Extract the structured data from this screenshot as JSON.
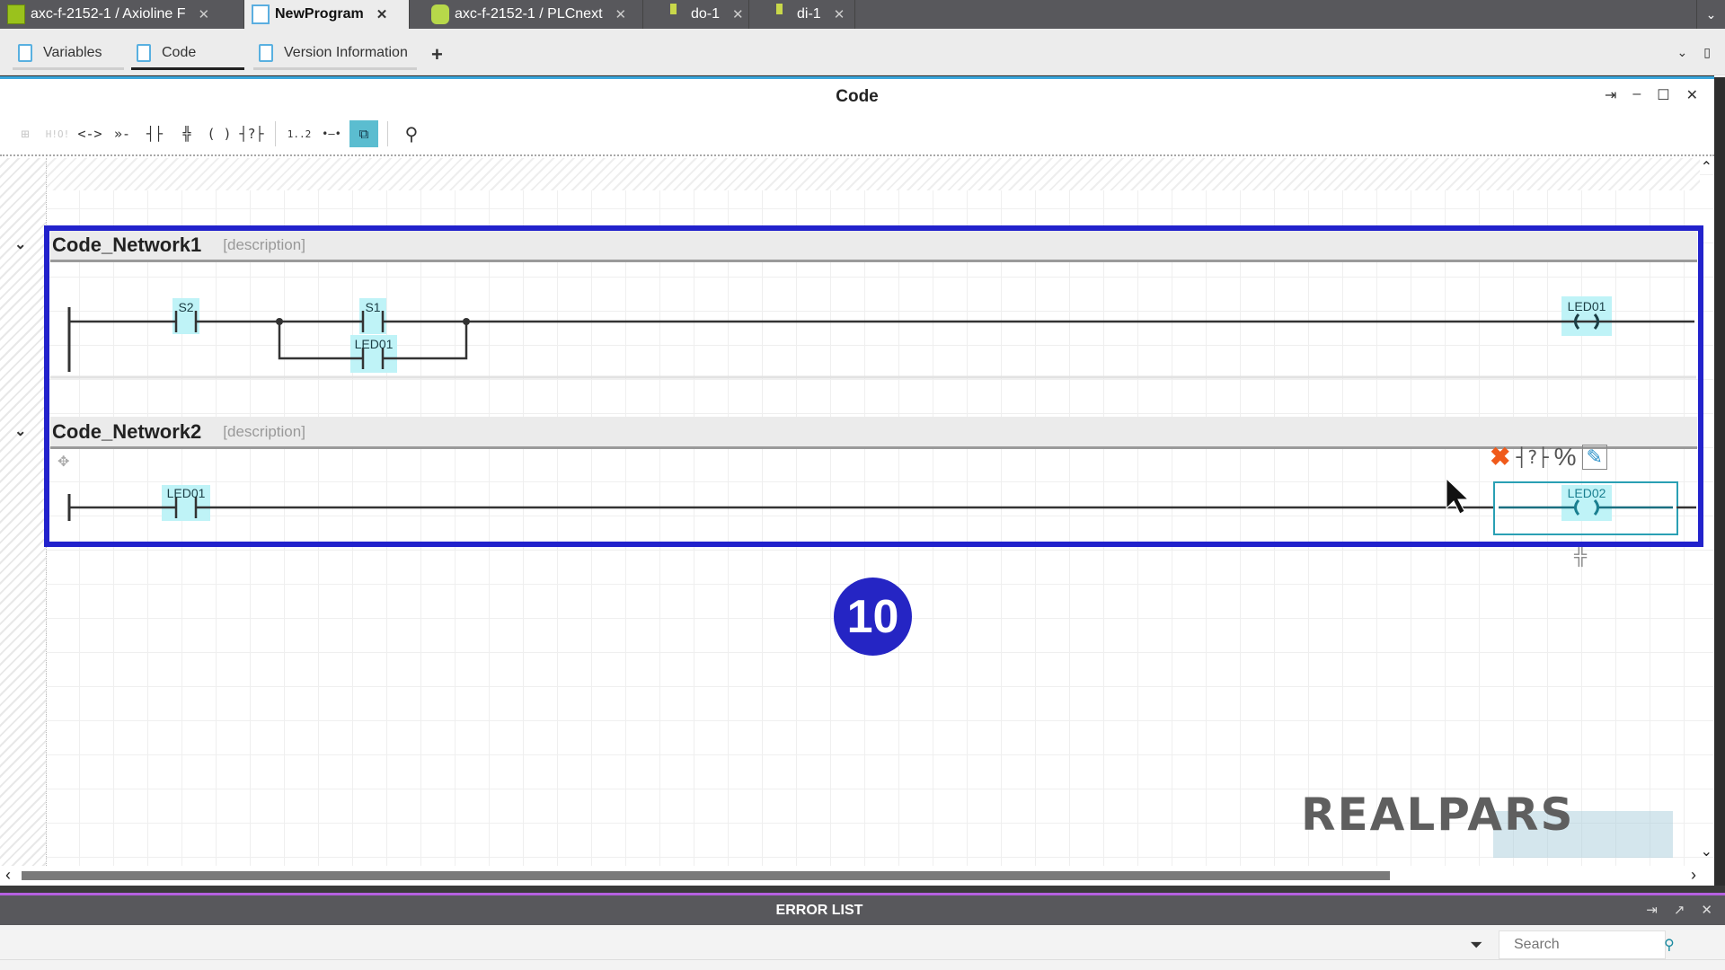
{
  "doc_tabs": [
    {
      "label": "axc-f-2152-1 / Axioline F",
      "icon": "axioline-bus-icon",
      "active": false
    },
    {
      "label": "NewProgram",
      "icon": "program-icon",
      "active": true
    },
    {
      "label": "axc-f-2152-1 / PLCnext",
      "icon": "plcnext-icon",
      "active": false
    },
    {
      "label": "do-1",
      "icon": "module-icon",
      "active": false
    },
    {
      "label": "di-1",
      "icon": "module-icon",
      "active": false
    }
  ],
  "tab_close_glyph": "✕",
  "tabs_overflow_glyph": "⌄",
  "sub_tabs": [
    {
      "label": "Variables",
      "icon": "variables-icon",
      "active": false
    },
    {
      "label": "Code",
      "icon": "code-icon",
      "active": true
    },
    {
      "label": "Version Information",
      "icon": "clipboard-icon",
      "active": false
    }
  ],
  "add_tab_glyph": "+",
  "sub_tabs_right": {
    "dropdown": "⌄",
    "maximize": "▯"
  },
  "pane": {
    "title": "Code",
    "controls": {
      "pin": "⇥",
      "minimize": "–",
      "maximize": "☐",
      "close": "✕"
    }
  },
  "toolbar": {
    "items": [
      {
        "name": "add-network",
        "glyph": "⊞",
        "dim": true
      },
      {
        "name": "hide-show",
        "glyph": "H!O!",
        "dim": true
      },
      {
        "name": "insert-coil-left",
        "glyph": "<->"
      },
      {
        "name": "insert-jump",
        "glyph": "»-"
      },
      {
        "name": "insert-contact",
        "glyph": "┤├"
      },
      {
        "name": "insert-function-block",
        "glyph": "╬"
      },
      {
        "name": "insert-coil",
        "glyph": "( )"
      },
      {
        "name": "insert-edge-contact",
        "glyph": "┤?├"
      },
      {
        "name": "numbering",
        "glyph": "1..2"
      },
      {
        "name": "connection",
        "glyph": "•—•"
      },
      {
        "name": "auto-connect",
        "glyph": "⧉",
        "active": true
      },
      {
        "name": "find",
        "glyph": "⚲"
      }
    ]
  },
  "networks": [
    {
      "title": "Code_Network1",
      "description": "[description]",
      "elements": [
        {
          "type": "contact-no",
          "variable": "S2"
        },
        {
          "type": "contact-no",
          "variable": "S1"
        },
        {
          "type": "contact-no",
          "variable": "LED01",
          "branch": "parallel"
        },
        {
          "type": "coil",
          "variable": "LED01"
        }
      ]
    },
    {
      "title": "Code_Network2",
      "description": "[description]",
      "elements": [
        {
          "type": "contact-no",
          "variable": "LED01"
        },
        {
          "type": "coil",
          "variable": "LED02",
          "selected": true
        }
      ]
    }
  ],
  "element_popup": {
    "delete": "✖",
    "negate": "┤?├",
    "toggle": "%",
    "edit": "✎"
  },
  "collapse_glyph": "⌄",
  "step_badge": "10",
  "watermark": "REALPARS",
  "hscroll": {
    "left": "‹",
    "right": "›"
  },
  "vscroll": {
    "up": "⌃",
    "down": "⌄"
  },
  "error_list": {
    "title": "ERROR LIST",
    "controls": {
      "pin": "⇥",
      "float": "↗",
      "close": "✕"
    },
    "search_placeholder": "Search",
    "filter_glyph": "⏷",
    "search_icon_glyph": "⚲"
  },
  "colors": {
    "network_frame": "#2222cc",
    "badge": "#2525c4",
    "accent_blue": "#3aa6dc",
    "highlight": "#bff3f7",
    "error_accent": "#b560e0",
    "delete_red": "#f05a1a"
  }
}
